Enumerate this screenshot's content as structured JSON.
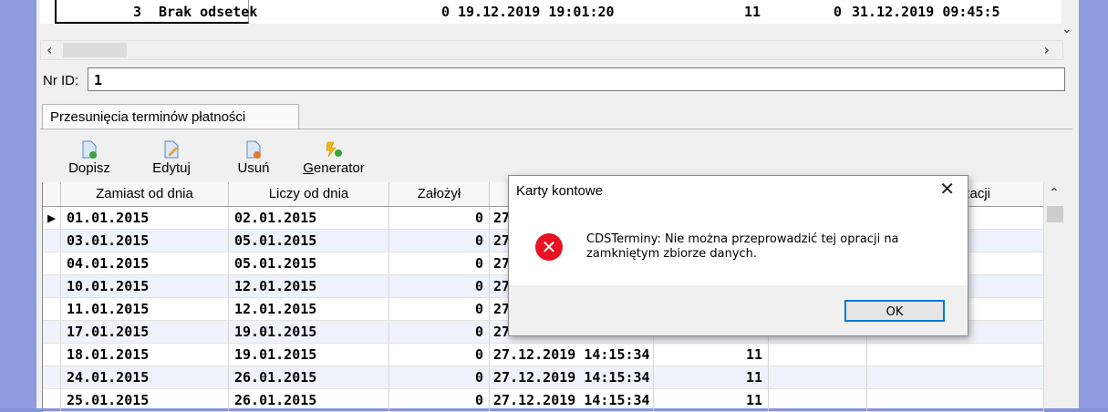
{
  "top_row": {
    "num": "3",
    "name": "Brak odsetek",
    "col3": "0",
    "date1": "19.12.2019 19:01:20",
    "col5": "11",
    "col6": "0",
    "date2": "31.12.2019 09:45:5"
  },
  "nr_id": {
    "label": "Nr ID:",
    "value": "1"
  },
  "tab": {
    "label": "Przesunięcia terminów płatności"
  },
  "toolbar": [
    {
      "label": "Dopisz",
      "icon": "page-add-icon"
    },
    {
      "label": "Edytuj",
      "icon": "page-edit-icon"
    },
    {
      "label": "Usuń",
      "icon": "page-delete-icon"
    },
    {
      "label": "Generator",
      "icon": "generator-icon"
    }
  ],
  "grid": {
    "headers": [
      "Zamiast od dnia",
      "Liczy od dnia",
      "Założył",
      "",
      "",
      "",
      "alizacji"
    ],
    "rows": [
      {
        "indicator": "▶",
        "c1": "01.01.2015",
        "c2": "02.01.2015",
        "c3": "0",
        "c4": "27",
        "c5": ""
      },
      {
        "indicator": "",
        "c1": "03.01.2015",
        "c2": "05.01.2015",
        "c3": "0",
        "c4": "27",
        "c5": ""
      },
      {
        "indicator": "",
        "c1": "04.01.2015",
        "c2": "05.01.2015",
        "c3": "0",
        "c4": "27",
        "c5": ""
      },
      {
        "indicator": "",
        "c1": "10.01.2015",
        "c2": "12.01.2015",
        "c3": "0",
        "c4": "27",
        "c5": ""
      },
      {
        "indicator": "",
        "c1": "11.01.2015",
        "c2": "12.01.2015",
        "c3": "0",
        "c4": "27",
        "c5": ""
      },
      {
        "indicator": "",
        "c1": "17.01.2015",
        "c2": "19.01.2015",
        "c3": "0",
        "c4": "27.12.2019 14:15:34",
        "c5": "11"
      },
      {
        "indicator": "",
        "c1": "18.01.2015",
        "c2": "19.01.2015",
        "c3": "0",
        "c4": "27.12.2019 14:15:34",
        "c5": "11"
      },
      {
        "indicator": "",
        "c1": "24.01.2015",
        "c2": "26.01.2015",
        "c3": "0",
        "c4": "27.12.2019 14:15:34",
        "c5": "11"
      },
      {
        "indicator": "",
        "c1": "25.01.2015",
        "c2": "26.01.2015",
        "c3": "0",
        "c4": "27.12.2019 14:15:34",
        "c5": "11"
      }
    ]
  },
  "dialog": {
    "title": "Karty kontowe",
    "close": "✕",
    "error_glyph": "✕",
    "message": "CDSTerminy: Nie można przeprowadzić tej opracji na zamkniętym zbiorze danych.",
    "ok": "OK"
  },
  "colors": {
    "window_bg": "#f0f0f0",
    "desktop": "#8793d8",
    "error": "#e81123",
    "focus": "#0078d7"
  }
}
